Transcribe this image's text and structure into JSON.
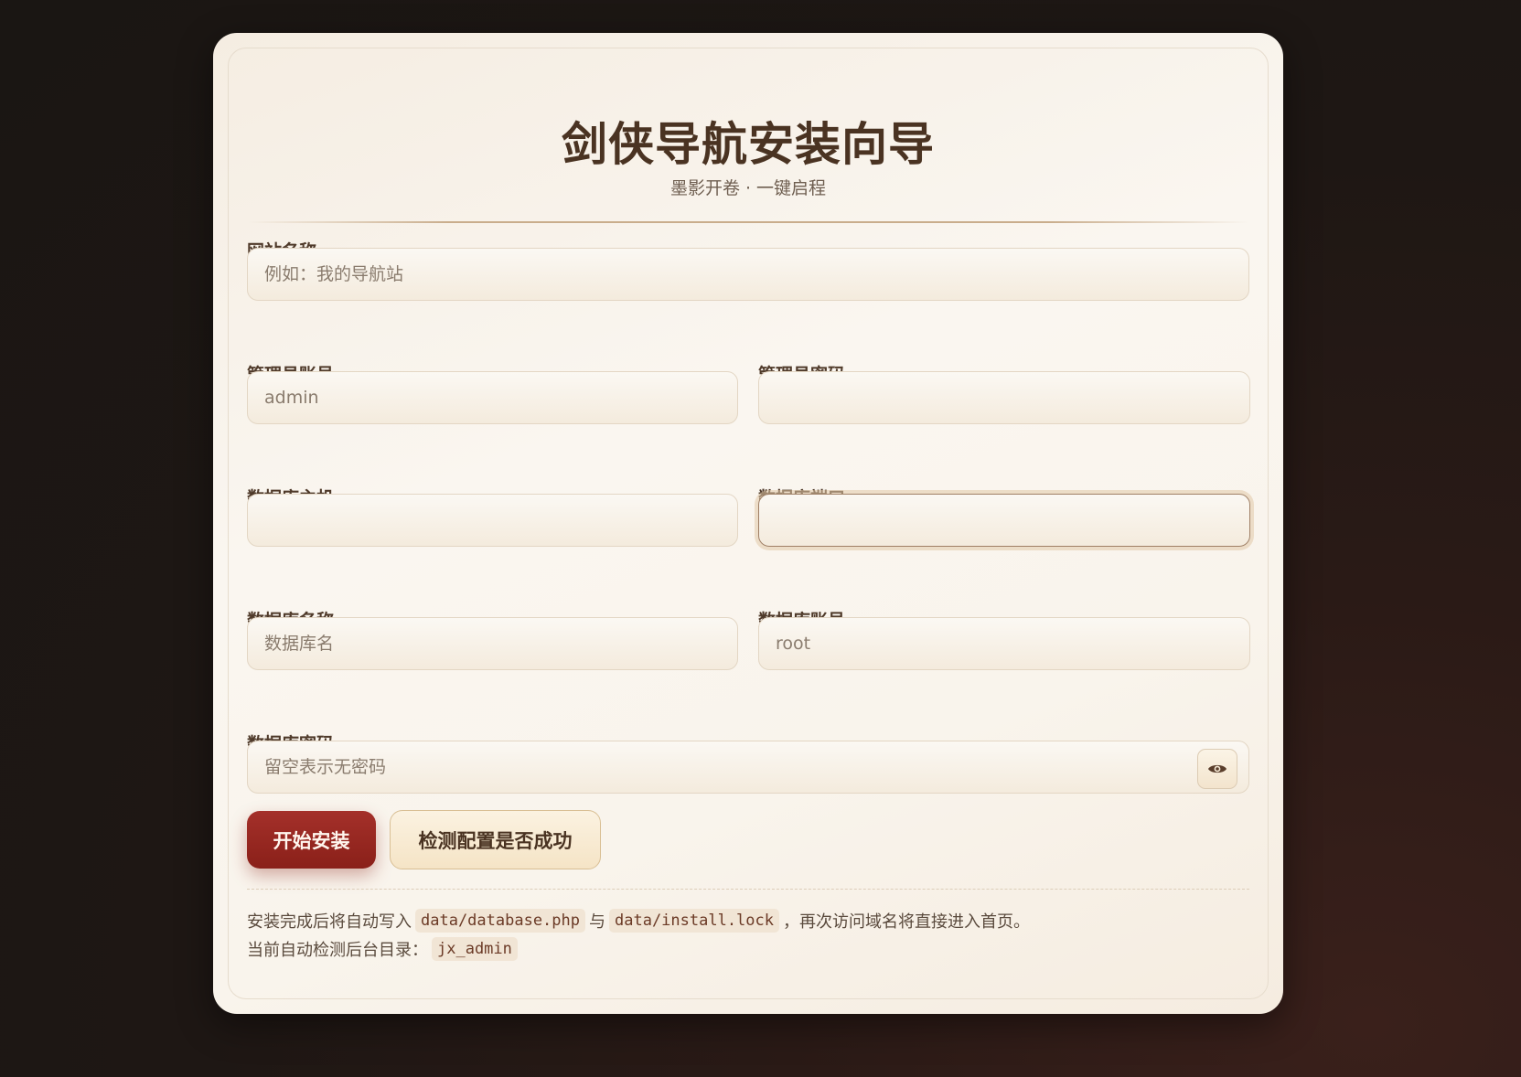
{
  "header": {
    "title": "剑侠导航安装向导",
    "subtitle": "墨影开卷 · 一键启程"
  },
  "form": {
    "site_name": {
      "label": "网站名称",
      "placeholder": "例如：我的导航站",
      "value": ""
    },
    "admin_user": {
      "label": "管理员账号",
      "placeholder": "admin",
      "value": ""
    },
    "admin_pass": {
      "label": "管理员密码",
      "placeholder": "",
      "value": ""
    },
    "db_host": {
      "label": "数据库主机",
      "placeholder": "",
      "value": ""
    },
    "db_port": {
      "label": "数据库端口",
      "placeholder": "",
      "value": ""
    },
    "db_name": {
      "label": "数据库名称",
      "placeholder": "数据库名",
      "value": ""
    },
    "db_user": {
      "label": "数据库账号",
      "placeholder": "root",
      "value": ""
    },
    "db_pass": {
      "label": "数据库密码",
      "placeholder": "留空表示无密码",
      "value": "",
      "toggle_icon": "eye-icon"
    }
  },
  "actions": {
    "install_label": "开始安装",
    "check_label": "检测配置是否成功"
  },
  "notes": {
    "line1_prefix": "安装完成后将自动写入",
    "file1": "data/database.php",
    "line1_mid": "与",
    "file2": "data/install.lock",
    "line1_suffix": "，再次访问域名将直接进入首页。",
    "line2_prefix": "当前自动检测后台目录：",
    "admin_dir": "jx_admin"
  },
  "colors": {
    "accent": "#9a2a22",
    "title": "#4a3322",
    "card_bg": "#faf6f0",
    "page_bg": "#1e1714"
  }
}
